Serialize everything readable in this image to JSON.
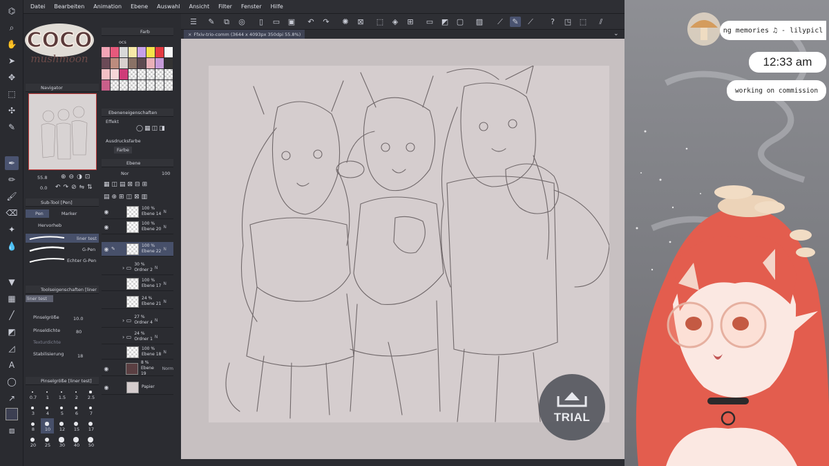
{
  "menu": [
    "Datei",
    "Bearbeiten",
    "Animation",
    "Ebene",
    "Auswahl",
    "Ansicht",
    "Filter",
    "Fenster",
    "Hilfe"
  ],
  "logo": {
    "line1": "COCO",
    "line2": "mushmoon"
  },
  "panels": {
    "color_set": {
      "title": "Farb",
      "set_name": "ocs"
    },
    "navigator": {
      "title": "Navigator",
      "zoom": "55.8",
      "angle": "0.0"
    },
    "layer_props": {
      "title": "Ebeneneigenschaften",
      "effect_label": "Effekt",
      "expression_label": "Ausdrucksfarbe",
      "expression_value": "Farbe"
    },
    "layers_panel": {
      "title": "Ebene",
      "blend_mode": "Nor",
      "opacity": "100"
    },
    "subtool": {
      "title": "Sub-Tool [Pen]",
      "tabs": [
        "Pen",
        "Marker"
      ],
      "group": "Hervorheb",
      "strokes": [
        "liner test",
        "G-Pen",
        "Echter G-Pen"
      ]
    },
    "tool_props": {
      "title": "Toolseigenschaften [liner",
      "preset": "liner test",
      "brush_size_label": "Pinselgröße",
      "brush_size_value": "10.0",
      "density_label": "Pinseldichte",
      "density_value": "80",
      "texture_label": "Texturdichte",
      "stabil_label": "Stabilisierung",
      "stabil_value": "18"
    },
    "brush_size": {
      "title": "Pinselgröße [liner test]",
      "sizes": [
        "0.7",
        "1",
        "1.5",
        "2",
        "2.5",
        "3",
        "4",
        "5",
        "6",
        "7",
        "8",
        "10",
        "12",
        "15",
        "17",
        "20",
        "25",
        "30",
        "40",
        "50"
      ]
    }
  },
  "layers": [
    {
      "opacity": "100 %",
      "mode": "N",
      "name": "Ebene 14",
      "visible": true,
      "folder": false,
      "selected": false
    },
    {
      "opacity": "100 %",
      "mode": "N",
      "name": "Ebene 20",
      "visible": true,
      "folder": false,
      "selected": false
    },
    {
      "opacity": "100 %",
      "mode": "N",
      "name": "Ebene 22",
      "visible": true,
      "folder": false,
      "selected": true
    },
    {
      "opacity": "30 %",
      "mode": "N",
      "name": "Ordner 2",
      "visible": false,
      "folder": true,
      "selected": false
    },
    {
      "opacity": "100 %",
      "mode": "N",
      "name": "Ebene 17",
      "visible": false,
      "folder": false,
      "selected": false
    },
    {
      "opacity": "24 %",
      "mode": "N",
      "name": "Ebene 21",
      "visible": false,
      "folder": false,
      "selected": false
    },
    {
      "opacity": "27 %",
      "mode": "N",
      "name": "Ordner 4",
      "visible": false,
      "folder": true,
      "selected": false
    },
    {
      "opacity": "24 %",
      "mode": "N",
      "name": "Ordner 1",
      "visible": false,
      "folder": true,
      "selected": false
    },
    {
      "opacity": "100 %",
      "mode": "N",
      "name": "Ebene 18",
      "visible": false,
      "folder": false,
      "selected": false
    },
    {
      "opacity": "8 %",
      "mode": "Norm",
      "name": "Ebene 19",
      "visible": true,
      "folder": false,
      "selected": false
    },
    {
      "opacity": "",
      "mode": "",
      "name": "Papier",
      "visible": true,
      "folder": false,
      "selected": false
    }
  ],
  "document": {
    "tab_title": "Ffxiv-trio-comm (3644 x 4093px 350dpi 55.8%)"
  },
  "trial": {
    "label": "TRIAL"
  },
  "overlay": {
    "song": "ng memories ♫ - lilypicl",
    "time": "12:33 am",
    "status": "working on commission"
  },
  "colors": {
    "accent": "#4a5370",
    "canvas": "#d5cdce",
    "panel": "#2b2c31"
  }
}
